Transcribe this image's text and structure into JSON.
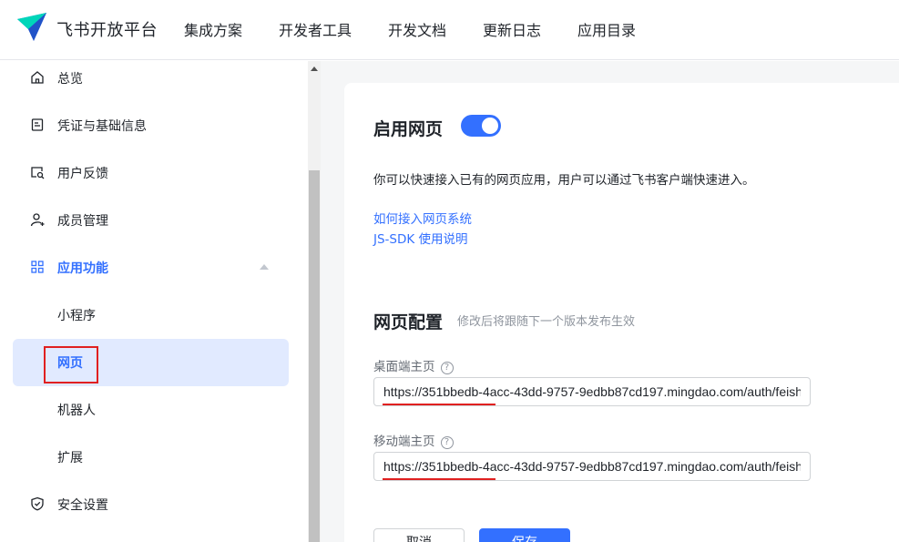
{
  "header": {
    "brand": "飞书开放平台",
    "nav": [
      "集成方案",
      "开发者工具",
      "开发文档",
      "更新日志",
      "应用目录"
    ],
    "logo_color": "#3370ff"
  },
  "sidebar": {
    "items": [
      {
        "label": "总览",
        "icon": "home-icon"
      },
      {
        "label": "凭证与基础信息",
        "icon": "credential-icon"
      },
      {
        "label": "用户反馈",
        "icon": "feedback-icon"
      },
      {
        "label": "成员管理",
        "icon": "member-add-icon"
      },
      {
        "label": "应用功能",
        "icon": "grid-icon"
      },
      {
        "label": "小程序"
      },
      {
        "label": "网页"
      },
      {
        "label": "机器人"
      },
      {
        "label": "扩展"
      },
      {
        "label": "安全设置",
        "icon": "shield-icon"
      }
    ],
    "selected": "网页",
    "expanded_group": "应用功能"
  },
  "main": {
    "enable_title": "启用网页",
    "toggle_on": true,
    "description": "你可以快速接入已有的网页应用，用户可以通过飞书客户端快速进入。",
    "links": [
      "如何接入网页系统",
      "JS-SDK 使用说明"
    ],
    "config_title": "网页配置",
    "config_hint": "修改后将跟随下一个版本发布生效",
    "desktop_label": "桌面端主页",
    "desktop_value": "https://351bbedb-4acc-43dd-9757-9edbb87cd197.mingdao.com/auth/feish",
    "mobile_label": "移动端主页",
    "mobile_value": "https://351bbedb-4acc-43dd-9757-9edbb87cd197.mingdao.com/auth/feish",
    "help_glyph": "?",
    "cancel_label": "取消",
    "save_label": "保存"
  },
  "colors": {
    "accent": "#3370ff",
    "annotation": "#e02020"
  }
}
